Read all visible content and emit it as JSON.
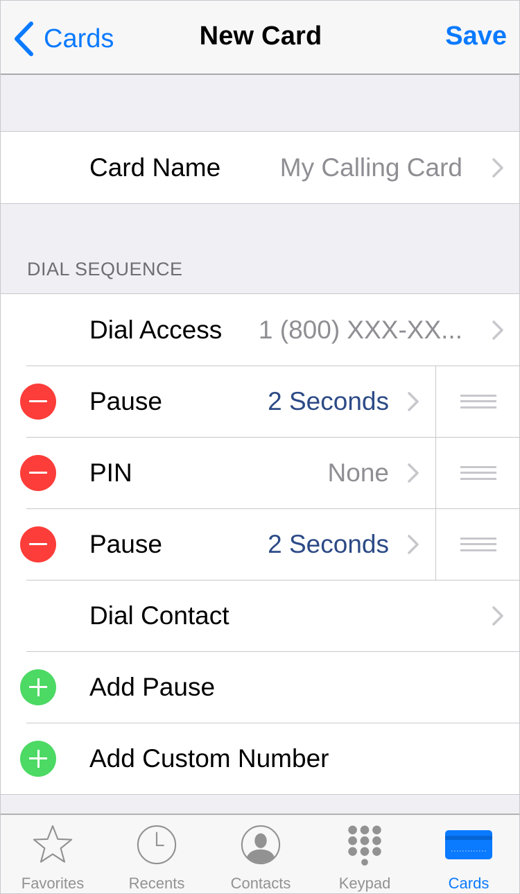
{
  "nav": {
    "back_label": "Cards",
    "title": "New Card",
    "save_label": "Save"
  },
  "card_name": {
    "label": "Card Name",
    "placeholder": "My Calling Card"
  },
  "section": {
    "header": "DIAL SEQUENCE"
  },
  "sequence": {
    "dial_access": {
      "label": "Dial Access",
      "value": "1 (800) XXX-XX..."
    },
    "steps": [
      {
        "label": "Pause",
        "value": "2 Seconds"
      },
      {
        "label": "PIN",
        "value": "None"
      },
      {
        "label": "Pause",
        "value": "2 Seconds"
      }
    ],
    "dial_contact": {
      "label": "Dial Contact"
    },
    "add_pause": {
      "label": "Add Pause"
    },
    "add_custom": {
      "label": "Add Custom Number"
    }
  },
  "tabs": [
    {
      "label": "Favorites",
      "icon": "star-icon",
      "active": false
    },
    {
      "label": "Recents",
      "icon": "clock-icon",
      "active": false
    },
    {
      "label": "Contacts",
      "icon": "contact-icon",
      "active": false
    },
    {
      "label": "Keypad",
      "icon": "keypad-icon",
      "active": false
    },
    {
      "label": "Cards",
      "icon": "card-icon",
      "active": true
    }
  ],
  "colors": {
    "accent": "#0a7aff",
    "delete": "#fc3d39",
    "add": "#4cd964",
    "value_blue": "#2c4a86"
  }
}
